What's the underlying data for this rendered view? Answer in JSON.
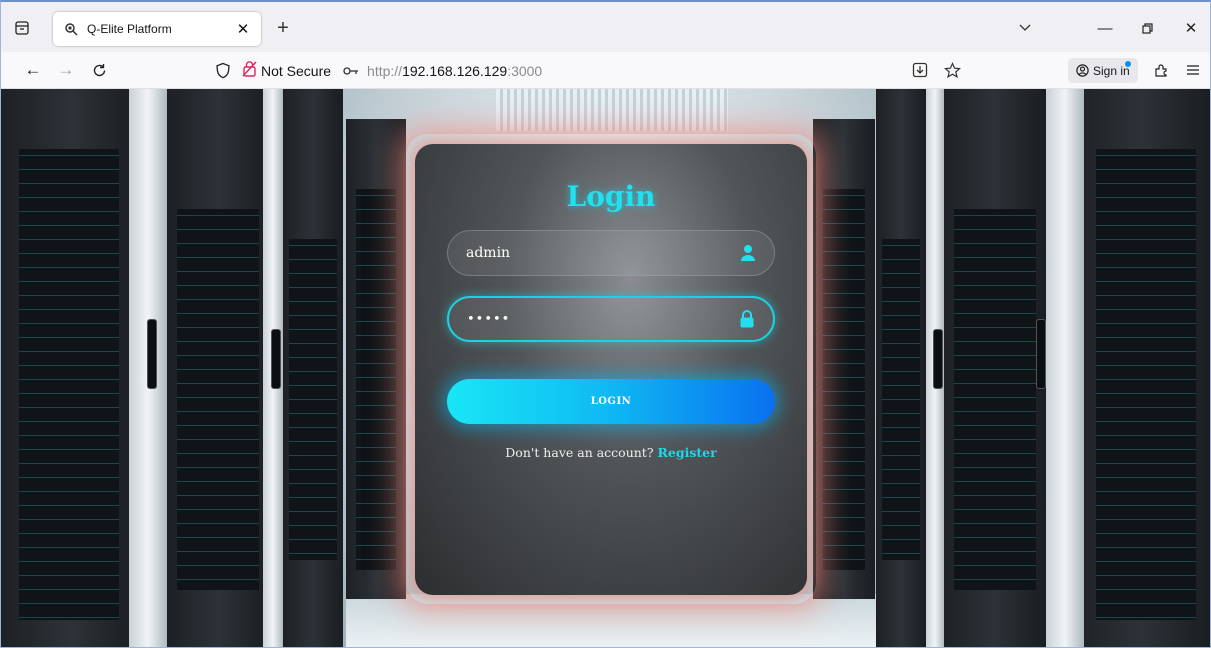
{
  "browser": {
    "tab": {
      "title": "Q-Elite Platform",
      "favicon": "magnifier-icon"
    },
    "url": {
      "security_label": "Not Secure",
      "prefix": "http://",
      "host": "192.168.126.129",
      "port": ":3000"
    },
    "signin_label": "Sign in",
    "icons": {
      "tab_overview": "tab-overview-icon",
      "close": "close-icon",
      "new_tab": "plus-icon",
      "list_tabs": "chevron-down-icon",
      "minimize": "minimize-icon",
      "restore": "restore-icon",
      "close_window": "close-icon",
      "back": "back-arrow-icon",
      "forward": "forward-arrow-icon",
      "reload": "reload-icon",
      "shield": "shield-icon",
      "insecure": "insecure-lock-icon",
      "key": "key-icon",
      "reader": "reader-view-icon",
      "bookmark": "star-icon",
      "extensions": "extensions-icon",
      "menu": "hamburger-menu-icon"
    }
  },
  "login": {
    "title": "Login",
    "username_value": "admin",
    "password_mask": "•••••",
    "button_label": "LOGIN",
    "register_prompt": "Don't have an account?",
    "register_link": "Register"
  },
  "colors": {
    "accent": "#22e0f0",
    "button_gradient_start": "#19e6f5",
    "button_gradient_end": "#0a70f0",
    "card_glow": "#eb8778"
  }
}
